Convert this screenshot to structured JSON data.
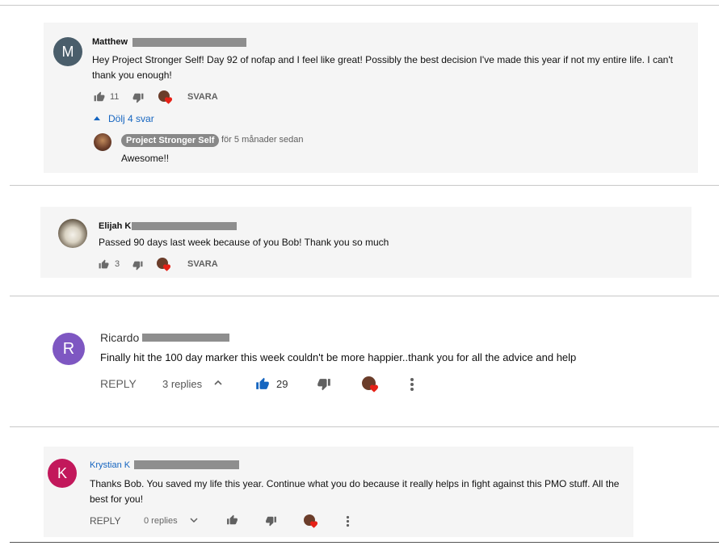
{
  "comments": [
    {
      "avatar_letter": "M",
      "avatar_color": "#4a5e6b",
      "author": "Matthew",
      "text": "Hey Project Stronger Self! Day 92 of nofap and I feel like great! Possibly the best decision I've made this year if not my entire life. I can't thank you enough!",
      "likes": "11",
      "reply_label": "SVARA",
      "replies_toggle": "Dölj 4 svar",
      "reply": {
        "author": "Project Stronger Self",
        "time": "för 5 månader sedan",
        "text": "Awesome!!"
      }
    },
    {
      "author": "Elijah K",
      "text": "Passed 90 days last week because of you Bob! Thank you so much",
      "likes": "3",
      "reply_label": "SVARA"
    },
    {
      "avatar_letter": "R",
      "avatar_color": "#7e57c2",
      "author": "Ricardo",
      "text": "Finally hit the 100 day marker this week couldn't be more happier..thank you for all the advice and help",
      "reply_label": "REPLY",
      "replies_label": "3 replies",
      "likes": "29",
      "accent_color": "#1565c0"
    },
    {
      "avatar_letter": "K",
      "avatar_color": "#c2185b",
      "author": "Krystian K",
      "text": "Thanks Bob. You saved my life this year. Continue what you do because it really helps in fight against this PMO stuff. All the best for you!",
      "reply_label": "REPLY",
      "replies_label": "0 replies"
    }
  ]
}
